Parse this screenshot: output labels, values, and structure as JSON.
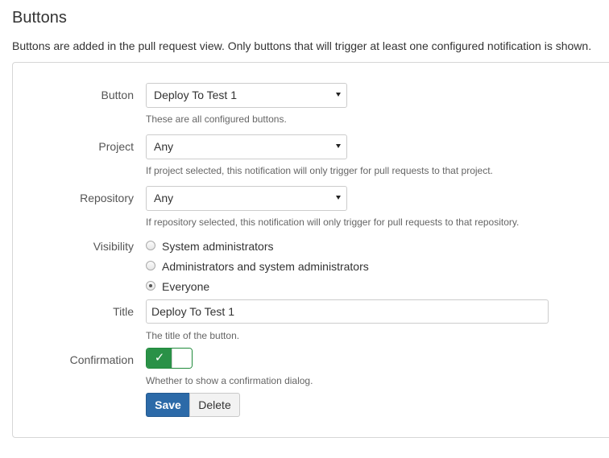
{
  "page": {
    "title": "Buttons",
    "description": "Buttons are added in the pull request view. Only buttons that will trigger at least one configured notification is shown."
  },
  "form": {
    "button": {
      "label": "Button",
      "value": "Deploy To Test 1",
      "help": "These are all configured buttons."
    },
    "project": {
      "label": "Project",
      "value": "Any",
      "help": "If project selected, this notification will only trigger for pull requests to that project."
    },
    "repository": {
      "label": "Repository",
      "value": "Any",
      "help": "If repository selected, this notification will only trigger for pull requests to that repository."
    },
    "visibility": {
      "label": "Visibility",
      "options": [
        {
          "label": "System administrators",
          "checked": false
        },
        {
          "label": "Administrators and system administrators",
          "checked": false
        },
        {
          "label": "Everyone",
          "checked": true
        }
      ]
    },
    "title": {
      "label": "Title",
      "value": "Deploy To Test 1",
      "help": "The title of the button."
    },
    "confirmation": {
      "label": "Confirmation",
      "enabled": true,
      "check_icon": "check-icon",
      "help": "Whether to show a confirmation dialog."
    }
  },
  "actions": {
    "save_label": "Save",
    "delete_label": "Delete"
  },
  "colors": {
    "primary": "#2c6aa8",
    "toggle_on": "#2a9147"
  }
}
